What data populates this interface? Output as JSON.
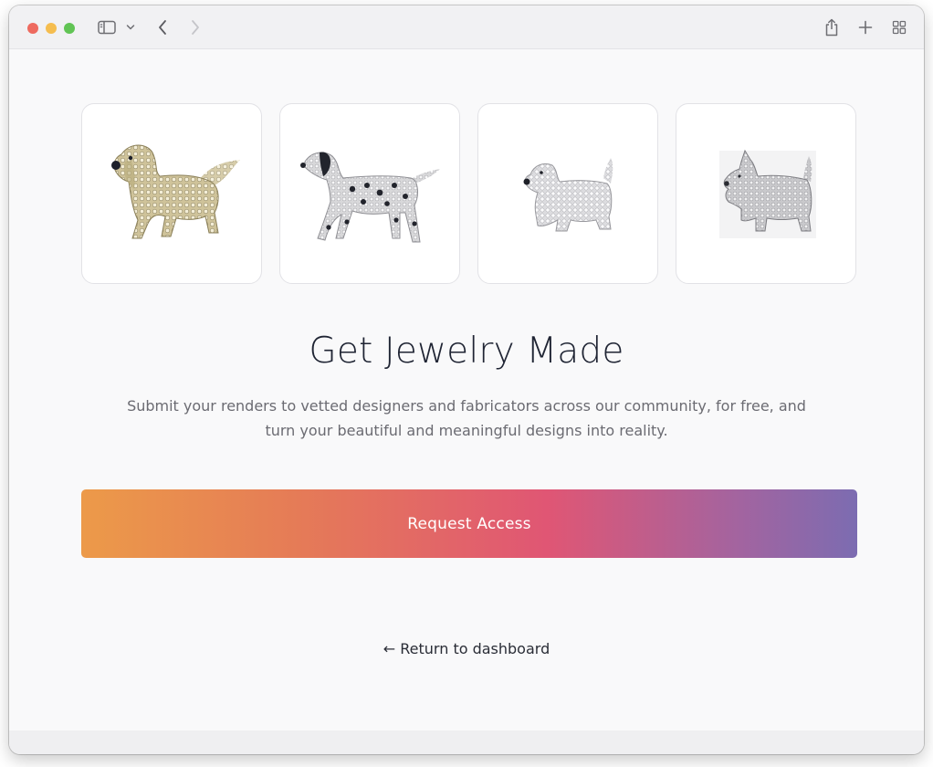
{
  "browser": {
    "icons": {
      "sidebar": "sidebar-toggle-icon",
      "chevron": "chevron-down-icon",
      "back": "back-arrow-icon",
      "forward": "forward-arrow-icon",
      "share": "share-icon",
      "new_tab": "plus-icon",
      "tab_overview": "tab-overview-icon"
    }
  },
  "gallery": {
    "items": [
      {
        "subject": "golden retriever brooch"
      },
      {
        "subject": "dalmatian brooch"
      },
      {
        "subject": "terrier brooch"
      },
      {
        "subject": "scottie dog brooch"
      }
    ]
  },
  "hero": {
    "title": "Get Jewelry Made",
    "subtitle": "Submit your renders to vetted designers and fabricators across our community, for free, and turn your beautiful and meaningful designs into reality."
  },
  "cta": {
    "label": "Request Access",
    "gradient": [
      "#ec9a49",
      "#e05674",
      "#7c6cb1"
    ]
  },
  "footer_link": {
    "label": "← Return to dashboard"
  }
}
